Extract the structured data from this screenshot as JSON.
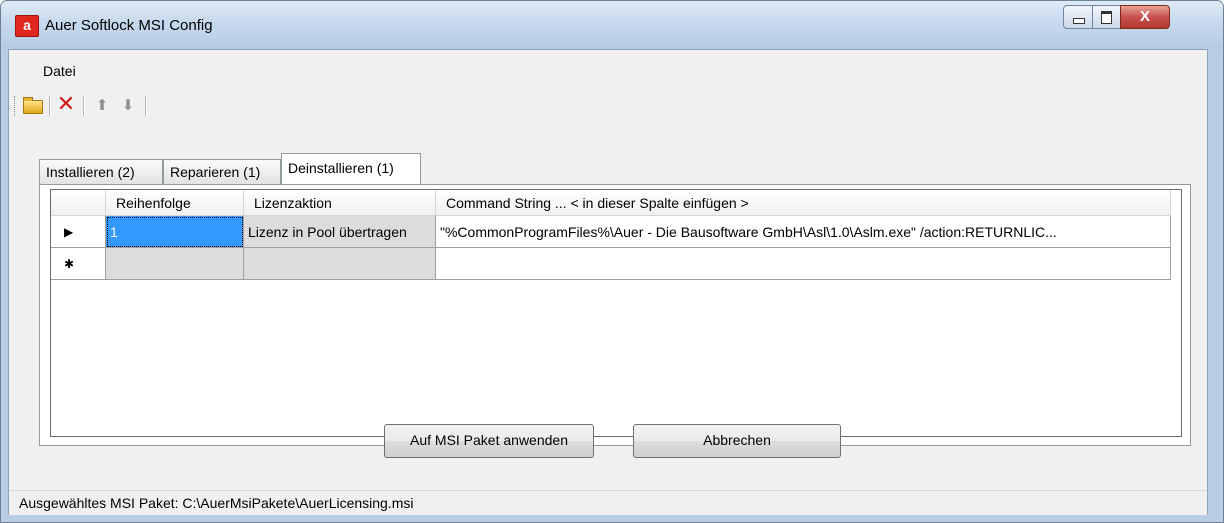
{
  "window": {
    "title": "Auer Softlock MSI Config",
    "icon_letter": "a",
    "close_symbol": "X"
  },
  "menu": {
    "items": [
      "Datei"
    ]
  },
  "toolbar": {
    "icons": [
      "open-folder-icon",
      "delete-icon",
      "move-up-icon",
      "move-down-icon"
    ],
    "up_symbol": "⬆",
    "down_symbol": "⬇",
    "delete_symbol": "✕"
  },
  "tabs": [
    {
      "label": "Installieren (2)",
      "active": false
    },
    {
      "label": "Reparieren (1)",
      "active": false
    },
    {
      "label": "Deinstallieren (1)",
      "active": true
    }
  ],
  "grid": {
    "columns": [
      "Reihenfolge",
      "Lizenzaktion",
      "Command String ... < in dieser Spalte einfügen >"
    ],
    "rows": [
      {
        "marker": "▶",
        "reihenfolge": "1",
        "lizenzaktion": "Lizenz in Pool übertragen",
        "command": "\"%CommonProgramFiles%\\Auer - Die Bausoftware GmbH\\Asl\\1.0\\Aslm.exe\" /action:RETURNLIC..."
      },
      {
        "marker": "✱",
        "reihenfolge": "",
        "lizenzaktion": "",
        "command": ""
      }
    ]
  },
  "buttons": {
    "apply": "Auf MSI Paket anwenden",
    "cancel": "Abbrechen"
  },
  "status": {
    "text": "Ausgewähltes MSI Paket: C:\\AuerMsiPakete\\AuerLicensing.msi"
  },
  "colors": {
    "selection": "#3399ff",
    "close_button": "#c75050"
  }
}
